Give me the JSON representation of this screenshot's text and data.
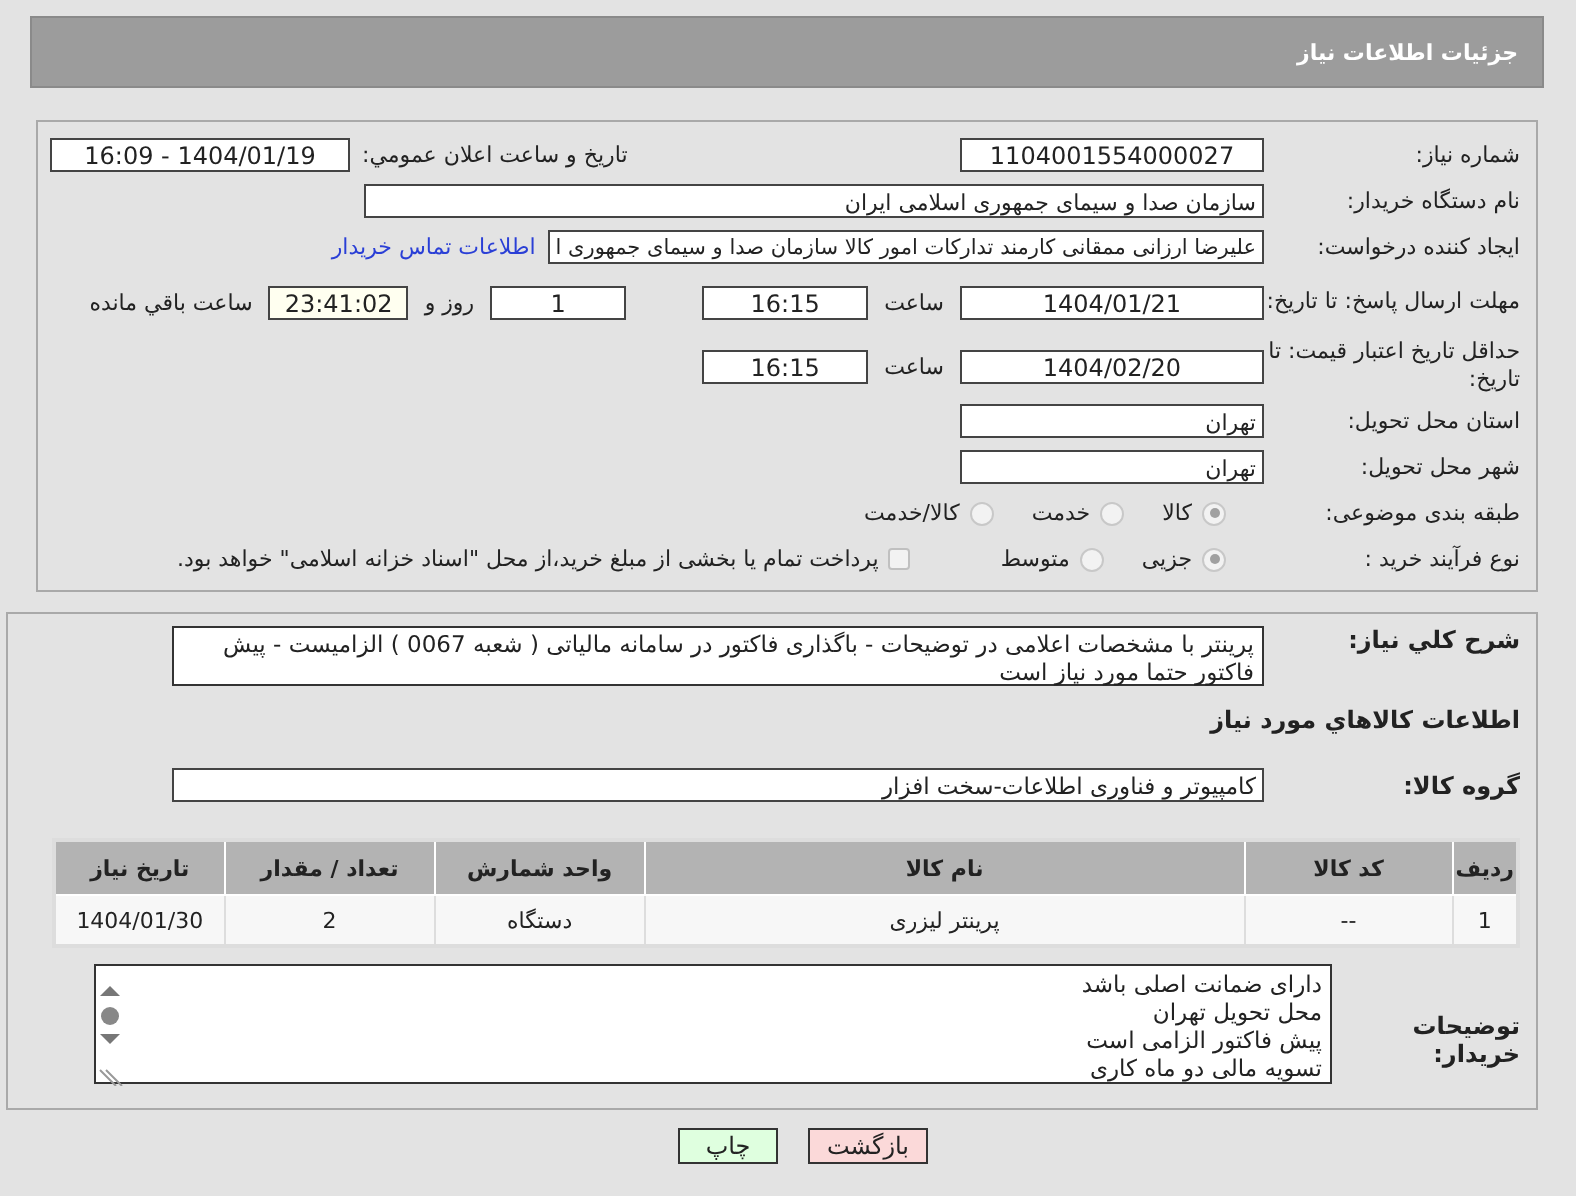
{
  "page_title": "جزئیات اطلاعات نیاز",
  "need_number": {
    "label": "شماره نیاز:",
    "value": "1104001554000027"
  },
  "announce": {
    "label": "تاریخ و ساعت اعلان عمومي:",
    "value": "1404/01/19 - 16:09"
  },
  "buyer_org": {
    "label": "نام دستگاه خریدار:",
    "value": "سازمان صدا و سیمای جمهوری اسلامی ایران"
  },
  "requester": {
    "label": "ایجاد کننده درخواست:",
    "value": "علیرضا ارزانی ممقانی کارمند تدارکات امور کالا سازمان صدا و سیمای جمهوری ا",
    "link": "اطلاعات تماس خریدار"
  },
  "reply_deadline": {
    "label": "مهلت ارسال پاسخ: تا تاریخ:",
    "date": "1404/01/21",
    "time_label": "ساعت",
    "time": "16:15",
    "days": "1",
    "days_label": "روز و",
    "remaining": "23:41:02",
    "remaining_label": "ساعت باقي مانده"
  },
  "price_validity": {
    "label": "حداقل تاریخ اعتبار قیمت: تا تاریخ:",
    "date": "1404/02/20",
    "time_label": "ساعت",
    "time": "16:15"
  },
  "province": {
    "label": "استان محل تحویل:",
    "value": "تهران"
  },
  "city": {
    "label": "شهر محل تحویل:",
    "value": "تهران"
  },
  "category": {
    "label": "طبقه بندی موضوعی:",
    "options": [
      {
        "label": "کالا",
        "selected": true
      },
      {
        "label": "خدمت",
        "selected": false
      },
      {
        "label": "کالا/خدمت",
        "selected": false
      }
    ]
  },
  "process": {
    "label": "نوع فرآیند خرید :",
    "options": [
      {
        "label": "جزیی",
        "selected": true
      },
      {
        "label": "متوسط",
        "selected": false
      }
    ],
    "treasury": {
      "label": "پرداخت تمام یا بخشی از مبلغ خرید،از محل \"اسناد خزانه اسلامی\" خواهد بود.",
      "checked": false
    }
  },
  "description": {
    "label": "شرح کلي نیاز:",
    "value": "پرینتر با مشخصات اعلامی در توضیحات - باگذاری فاکتور در سامانه مالیاتی ( شعبه 0067 ) الزامیست - پیش فاکتور حتما مورد نیاز است"
  },
  "goods_heading": "اطلاعات کالاهاي مورد نیاز",
  "goods_group": {
    "label": "گروه کالا:",
    "value": "کامپیوتر و فناوری اطلاعات-سخت افزار"
  },
  "table": {
    "columns": [
      "ردیف",
      "کد کالا",
      "نام کالا",
      "واحد شمارش",
      "تعداد / مقدار",
      "تاریخ نیاز"
    ],
    "rows": [
      [
        "1",
        "--",
        "پرینتر لیزری",
        "دستگاه",
        "2",
        "1404/01/30"
      ]
    ]
  },
  "buyer_notes": {
    "label": "توضیحات خریدار:",
    "lines": [
      "دارای ضمانت اصلی باشد",
      "محل تحویل تهران",
      "پیش فاکتور الزامی است",
      "تسویه مالی دو ماه کاری"
    ]
  },
  "buttons": [
    {
      "label": "بازگشت",
      "kind": "back"
    },
    {
      "label": "چاپ",
      "kind": "print"
    }
  ]
}
